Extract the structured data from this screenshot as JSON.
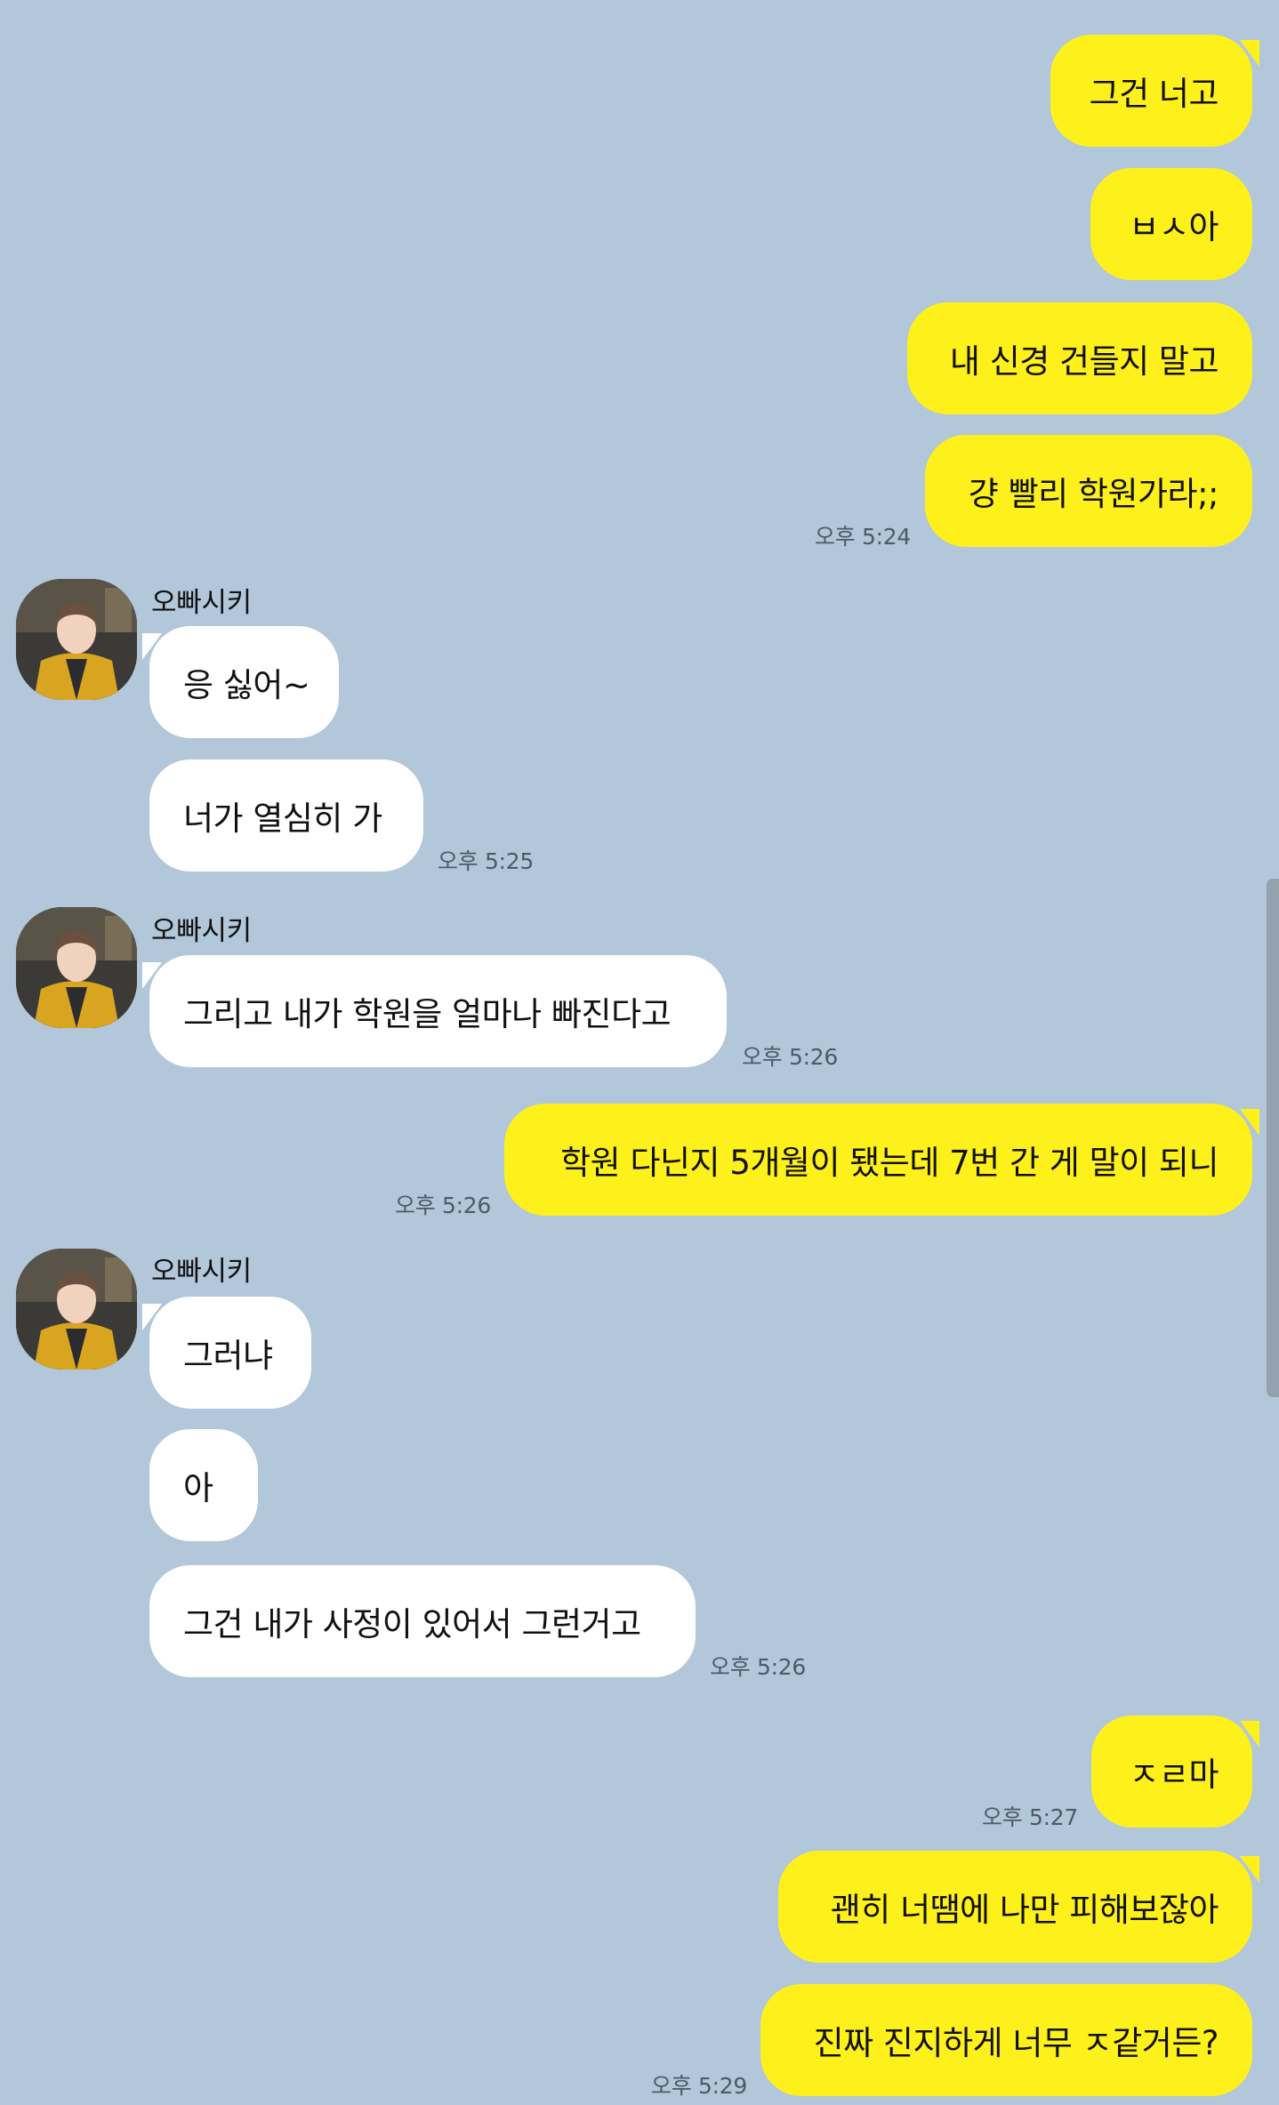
{
  "contact_name": "오빠시키",
  "colors": {
    "background": "#b2c7da",
    "my_bubble": "#fef01b",
    "their_bubble": "#ffffff"
  },
  "messages": [
    {
      "sender": "me",
      "text": "그건 너고"
    },
    {
      "sender": "me",
      "text": "ㅂㅅ아"
    },
    {
      "sender": "me",
      "text": "내 신경 건들지 말고"
    },
    {
      "sender": "me",
      "text": "걍 빨리 학원가라;;",
      "time": "오후 5:24"
    },
    {
      "sender": "other",
      "text": "응 싫어~"
    },
    {
      "sender": "other",
      "text": "너가 열심히 가",
      "time": "오후 5:25"
    },
    {
      "sender": "other",
      "text": "그리고 내가 학원을 얼마나 빠진다고",
      "time": "오후 5:26"
    },
    {
      "sender": "me",
      "text": "학원 다닌지 5개월이 됐는데 7번 간 게 말이 되니",
      "time": "오후 5:26"
    },
    {
      "sender": "other",
      "text": "그러냐"
    },
    {
      "sender": "other",
      "text": "아"
    },
    {
      "sender": "other",
      "text": "그건 내가 사정이 있어서 그런거고",
      "time": "오후 5:26"
    },
    {
      "sender": "me",
      "text": "ㅈㄹ마",
      "time": "오후 5:27"
    },
    {
      "sender": "me",
      "text": "괜히 너땜에 나만 피해보잖아"
    },
    {
      "sender": "me",
      "text": "진짜 진지하게 너무 ㅈ같거든?",
      "time": "오후 5:29"
    }
  ]
}
